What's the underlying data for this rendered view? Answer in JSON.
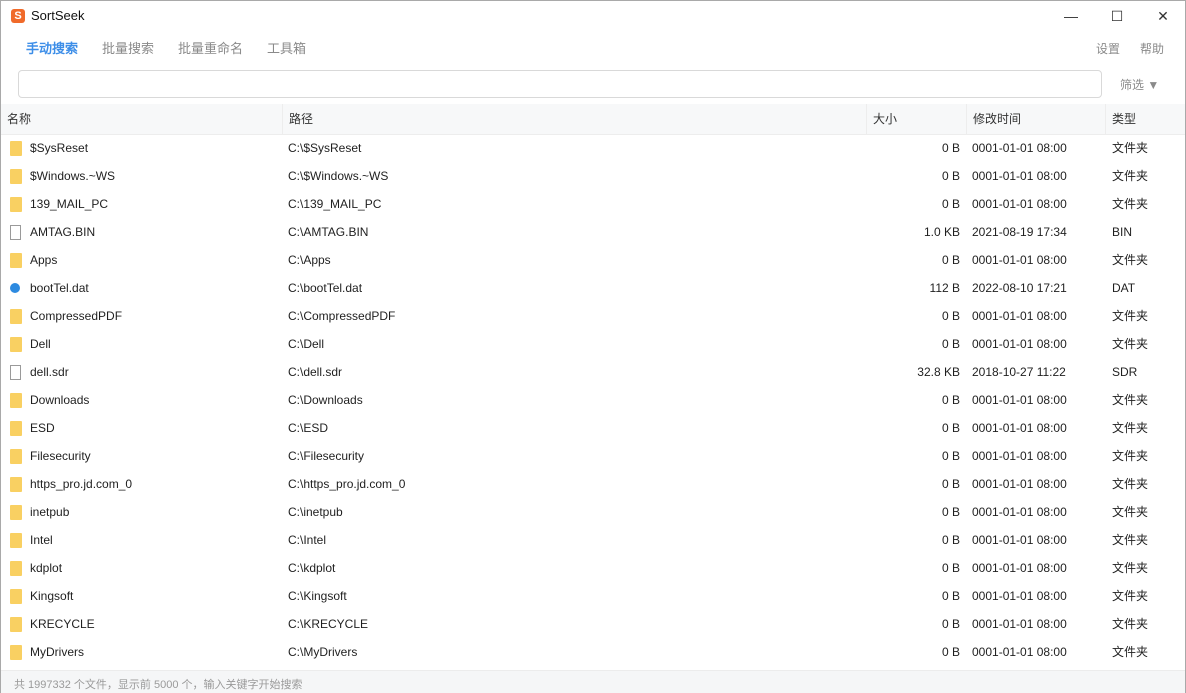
{
  "window": {
    "title": "SortSeek",
    "app_icon_letter": "S",
    "minimize": "—",
    "maximize": "☐",
    "close": "✕"
  },
  "nav": {
    "tabs": [
      "手动搜索",
      "批量搜索",
      "批量重命名",
      "工具箱"
    ],
    "active_tab": 0,
    "settings": "设置",
    "help": "帮助"
  },
  "search": {
    "value": "",
    "placeholder": "",
    "filter_label": "筛选 ▼"
  },
  "table": {
    "columns": [
      "名称",
      "路径",
      "大小",
      "修改时间",
      "类型"
    ],
    "rows": [
      {
        "icon": "folder-icon",
        "name": "$SysReset",
        "path": "C:\\$SysReset",
        "size": "0 B",
        "time": "0001-01-01 08:00",
        "type": "文件夹"
      },
      {
        "icon": "folder-icon",
        "name": "$Windows.~WS",
        "path": "C:\\$Windows.~WS",
        "size": "0 B",
        "time": "0001-01-01 08:00",
        "type": "文件夹"
      },
      {
        "icon": "folder-icon",
        "name": "139_MAIL_PC",
        "path": "C:\\139_MAIL_PC",
        "size": "0 B",
        "time": "0001-01-01 08:00",
        "type": "文件夹"
      },
      {
        "icon": "file-icon",
        "name": "AMTAG.BIN",
        "path": "C:\\AMTAG.BIN",
        "size": "1.0 KB",
        "time": "2021-08-19 17:34",
        "type": "BIN"
      },
      {
        "icon": "folder-icon",
        "name": "Apps",
        "path": "C:\\Apps",
        "size": "0 B",
        "time": "0001-01-01 08:00",
        "type": "文件夹"
      },
      {
        "icon": "dat-file-icon",
        "name": "bootTel.dat",
        "path": "C:\\bootTel.dat",
        "size": "112 B",
        "time": "2022-08-10 17:21",
        "type": "DAT"
      },
      {
        "icon": "folder-icon",
        "name": "CompressedPDF",
        "path": "C:\\CompressedPDF",
        "size": "0 B",
        "time": "0001-01-01 08:00",
        "type": "文件夹"
      },
      {
        "icon": "folder-icon",
        "name": "Dell",
        "path": "C:\\Dell",
        "size": "0 B",
        "time": "0001-01-01 08:00",
        "type": "文件夹"
      },
      {
        "icon": "file-icon",
        "name": "dell.sdr",
        "path": "C:\\dell.sdr",
        "size": "32.8 KB",
        "time": "2018-10-27 11:22",
        "type": "SDR"
      },
      {
        "icon": "folder-icon",
        "name": "Downloads",
        "path": "C:\\Downloads",
        "size": "0 B",
        "time": "0001-01-01 08:00",
        "type": "文件夹"
      },
      {
        "icon": "folder-icon",
        "name": "ESD",
        "path": "C:\\ESD",
        "size": "0 B",
        "time": "0001-01-01 08:00",
        "type": "文件夹"
      },
      {
        "icon": "folder-icon",
        "name": "Filesecurity",
        "path": "C:\\Filesecurity",
        "size": "0 B",
        "time": "0001-01-01 08:00",
        "type": "文件夹"
      },
      {
        "icon": "folder-icon",
        "name": "https_pro.jd.com_0",
        "path": "C:\\https_pro.jd.com_0",
        "size": "0 B",
        "time": "0001-01-01 08:00",
        "type": "文件夹"
      },
      {
        "icon": "folder-icon",
        "name": "inetpub",
        "path": "C:\\inetpub",
        "size": "0 B",
        "time": "0001-01-01 08:00",
        "type": "文件夹"
      },
      {
        "icon": "folder-icon",
        "name": "Intel",
        "path": "C:\\Intel",
        "size": "0 B",
        "time": "0001-01-01 08:00",
        "type": "文件夹"
      },
      {
        "icon": "folder-icon",
        "name": "kdplot",
        "path": "C:\\kdplot",
        "size": "0 B",
        "time": "0001-01-01 08:00",
        "type": "文件夹"
      },
      {
        "icon": "folder-icon",
        "name": "Kingsoft",
        "path": "C:\\Kingsoft",
        "size": "0 B",
        "time": "0001-01-01 08:00",
        "type": "文件夹"
      },
      {
        "icon": "folder-icon",
        "name": "KRECYCLE",
        "path": "C:\\KRECYCLE",
        "size": "0 B",
        "time": "0001-01-01 08:00",
        "type": "文件夹"
      },
      {
        "icon": "folder-icon",
        "name": "MyDrivers",
        "path": "C:\\MyDrivers",
        "size": "0 B",
        "time": "0001-01-01 08:00",
        "type": "文件夹"
      }
    ]
  },
  "status": {
    "text": "共 1997332 个文件，显示前 5000 个，输入关键字开始搜索"
  },
  "colors": {
    "accent": "#3d8ee8",
    "folder": "#f9d062",
    "app_icon": "#f06a2a"
  }
}
